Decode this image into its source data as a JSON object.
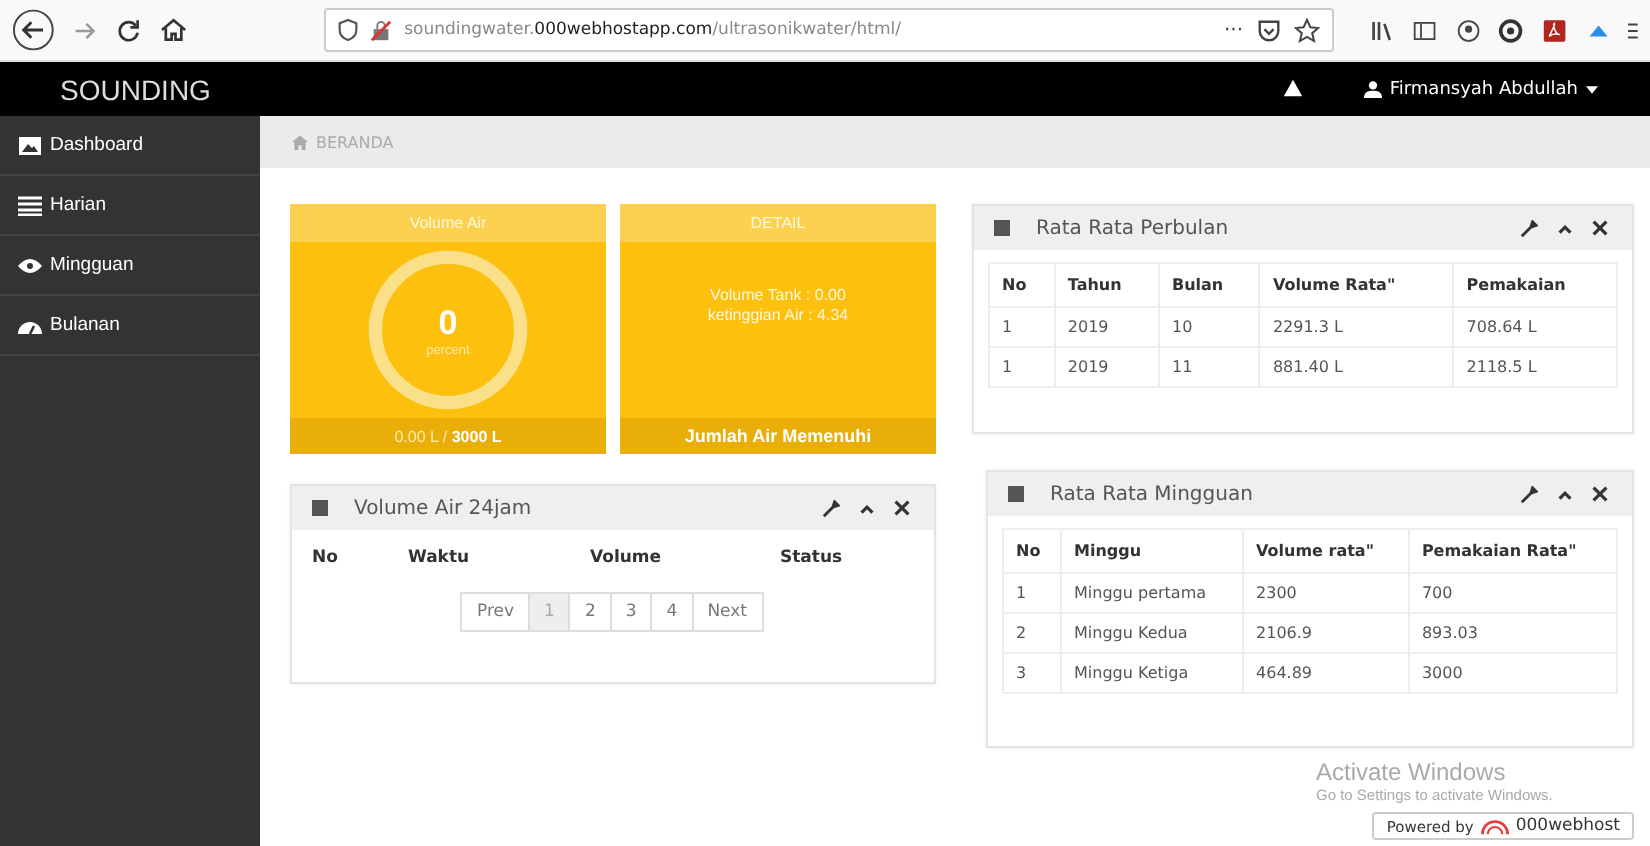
{
  "browser": {
    "url_start": "soundingwater.",
    "url_domain": "000webhostapp.com",
    "url_end": "/ultrasonikwater/html/",
    "more": "···"
  },
  "navbar": {
    "brand": "SOUNDING",
    "user": "Firmansyah Abdullah"
  },
  "sidebar": {
    "items": [
      {
        "label": "Dashboard",
        "kind": "dashboard"
      },
      {
        "label": "Harian",
        "kind": "list"
      },
      {
        "label": "Mingguan",
        "kind": "eye"
      },
      {
        "label": "Bulanan",
        "kind": "gauge"
      }
    ]
  },
  "breadcrumb": "BERANDA",
  "volume_card": {
    "title": "Volume Air",
    "value": "0",
    "unit": "percent",
    "level": 0,
    "footer": "0.00 L / **3000 L**"
  },
  "detail_card": {
    "title": "DETAIL",
    "lines": [
      "Volume Tank : 0.00",
      "ketinggian Air : 4.34"
    ],
    "footer": "Jumlah Air Memenuhi"
  },
  "hourly_panel": {
    "title": "Volume Air 24jam",
    "columns": [
      "No",
      "Waktu",
      "Volume",
      "Status"
    ],
    "pagination": [
      {
        "label": "Prev",
        "selected": false
      },
      {
        "label": "1",
        "selected": true
      },
      {
        "label": "2",
        "selected": false
      },
      {
        "label": "3",
        "selected": false
      },
      {
        "label": "4",
        "selected": false
      },
      {
        "label": "Next",
        "selected": false
      }
    ]
  },
  "monthly_panel": {
    "title": "Rata Rata Perbulan",
    "columns": [
      "No",
      "Tahun",
      "Bulan",
      "Volume Rata\"",
      "Pemakaian"
    ],
    "rows": [
      [
        "1",
        "2019",
        "10",
        "2291.3 L",
        "708.64 L"
      ],
      [
        "1",
        "2019",
        "11",
        "881.40 L",
        "2118.5 L"
      ]
    ]
  },
  "weekly_panel": {
    "title": "Rata Rata Mingguan",
    "columns": [
      "No",
      "Minggu",
      "Volume rata\"",
      "Pemakaian Rata\""
    ],
    "rows": [
      [
        "1",
        "Minggu pertama",
        "2300",
        "700"
      ],
      [
        "2",
        "Minggu Kedua",
        "2106.9",
        "893.03"
      ],
      [
        "3",
        "Minggu Ketiga",
        "464.89",
        "3000"
      ]
    ]
  },
  "activation": {
    "title": "Activate Windows",
    "subtitle": "Go to Settings to activate Windows."
  },
  "hosting_badge": {
    "prefix": "Powered by",
    "brand": "000webhost"
  }
}
